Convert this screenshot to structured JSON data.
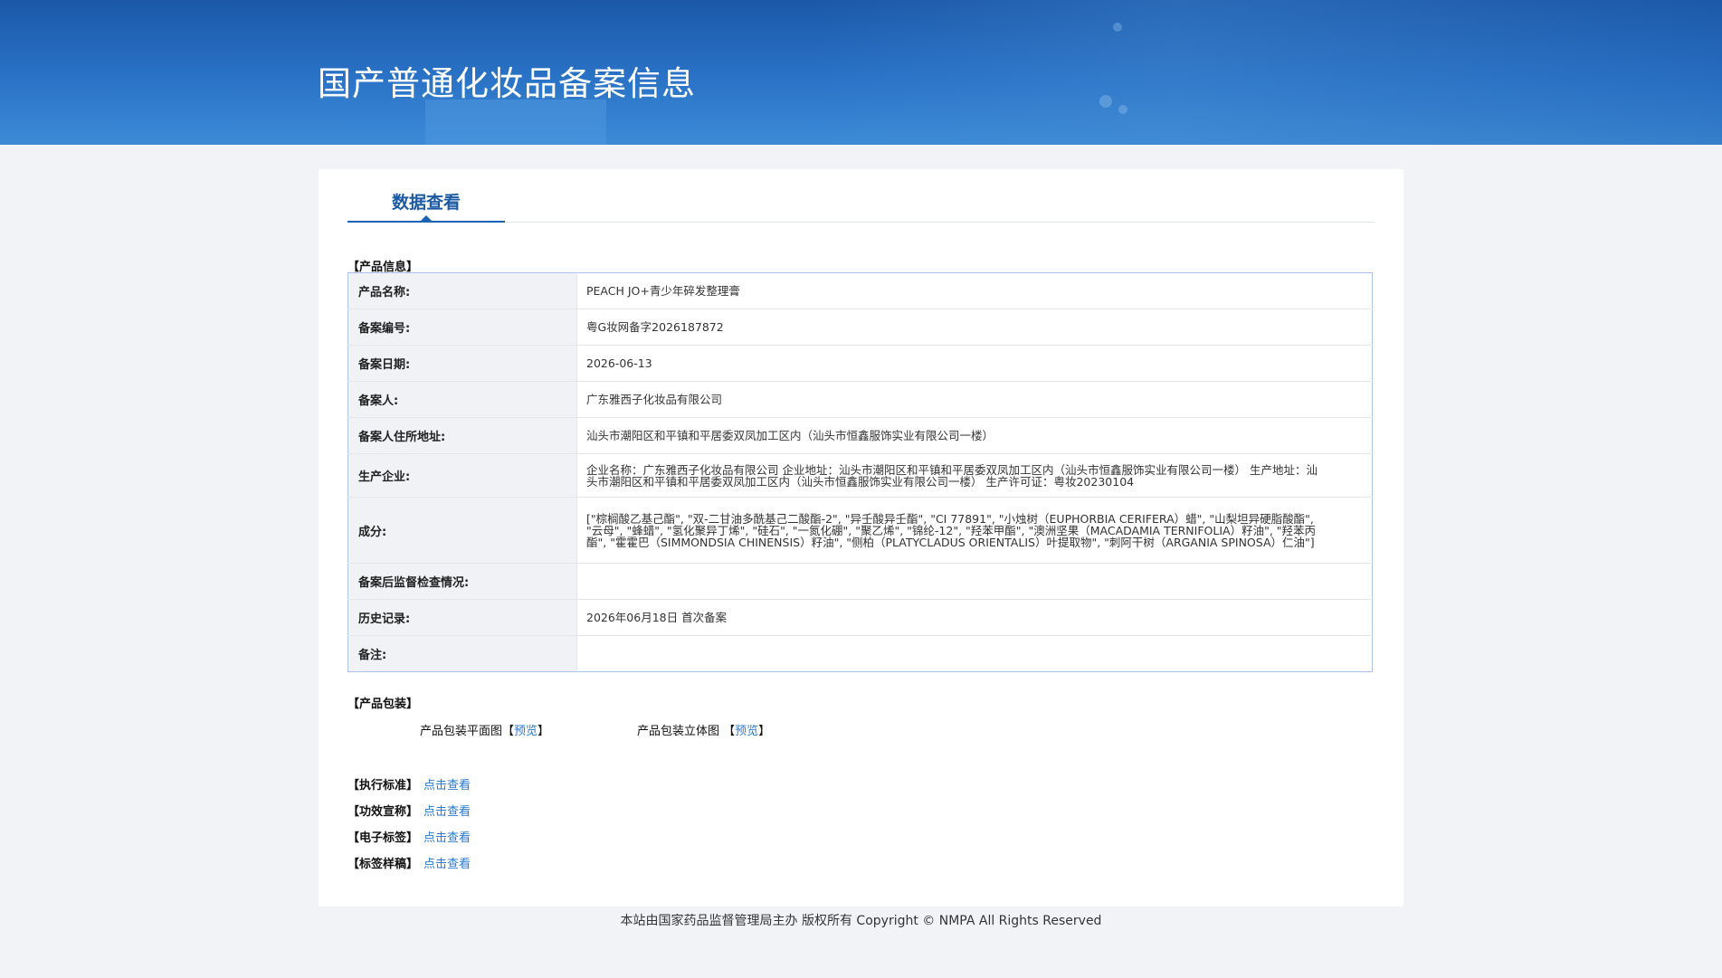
{
  "header": {
    "title": "国产普通化妆品备案信息"
  },
  "tab": {
    "label": "数据查看"
  },
  "product_info": {
    "section_label": "【产品信息】",
    "rows": [
      {
        "key": "产品名称:",
        "value": "PEACH JO+青少年碎发整理膏"
      },
      {
        "key": "备案编号:",
        "value": "粤G妆网备字2026187872"
      },
      {
        "key": "备案日期:",
        "value": "2026-06-13"
      },
      {
        "key": "备案人:",
        "value": "广东雅西子化妆品有限公司"
      },
      {
        "key": "备案人住所地址:",
        "value": "汕头市潮阳区和平镇和平居委双凤加工区内（汕头市恒鑫服饰实业有限公司一楼）"
      },
      {
        "key": "生产企业:",
        "value": "企业名称：广东雅西子化妆品有限公司 企业地址：汕头市潮阳区和平镇和平居委双凤加工区内（汕头市恒鑫服饰实业有限公司一楼） 生产地址：汕头市潮阳区和平镇和平居委双凤加工区内（汕头市恒鑫服饰实业有限公司一楼） 生产许可证：粤妆20230104"
      },
      {
        "key": "成分:",
        "value": "[\"棕榈酸乙基己酯\", \"双-二甘油多酰基己二酸酯-2\", \"异壬酸异壬酯\", \"CI 77891\", \"小烛树（EUPHORBIA CERIFERA）蜡\", \"山梨坦异硬脂酸酯\", \"云母\", \"蜂蜡\", \"氢化聚异丁烯\", \"硅石\", \"一氮化硼\", \"聚乙烯\", \"锦纶-12\", \"羟苯甲酯\", \"澳洲坚果（MACADAMIA TERNIFOLIA）籽油\", \"羟苯丙酯\", \"霍霍巴（SIMMONDSIA CHINENSIS）籽油\", \"侧柏（PLATYCLADUS ORIENTALIS）叶提取物\", \"刺阿干树（ARGANIA SPINOSA）仁油\"]"
      },
      {
        "key": "备案后监督检查情况:",
        "value": ""
      },
      {
        "key": "历史记录:",
        "value": "2026年06月18日 首次备案"
      },
      {
        "key": "备注:",
        "value": ""
      }
    ]
  },
  "packaging": {
    "section_label": "【产品包装】",
    "flat_label": "产品包装平面图【",
    "flat_link": "预览",
    "flat_close": "】",
    "solid_label": "产品包装立体图 【",
    "solid_link": "预览",
    "solid_close": "】"
  },
  "links": [
    {
      "label": "【执行标准】",
      "link": "点击查看"
    },
    {
      "label": "【功效宣称】",
      "link": "点击查看"
    },
    {
      "label": "【电子标签】",
      "link": "点击查看"
    },
    {
      "label": "【标签样稿】",
      "link": "点击查看"
    }
  ],
  "footer": {
    "text": "本站由国家药品监督管理局主办 版权所有 Copyright © NMPA All Rights Reserved"
  }
}
